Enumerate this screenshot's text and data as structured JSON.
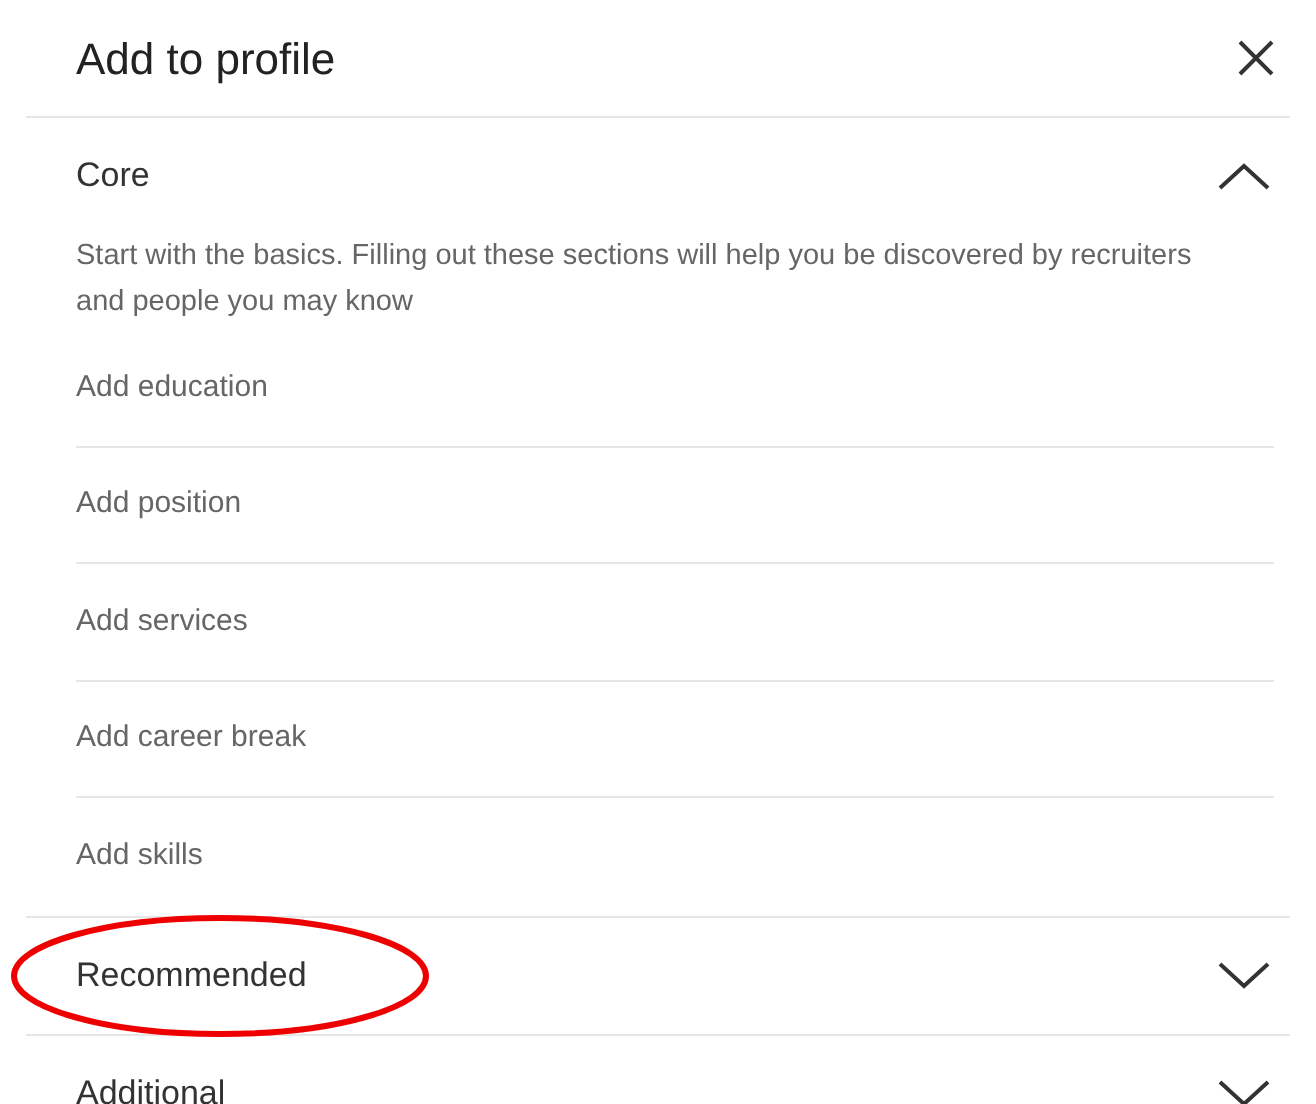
{
  "dialog": {
    "title": "Add to profile"
  },
  "sections": [
    {
      "title": "Core",
      "expanded": true,
      "circled": false,
      "description": "Start with the basics. Filling out these sections will help you be discovered by recruiters and people you may know",
      "items": [
        "Add education",
        "Add position",
        "Add services",
        "Add career break",
        "Add skills"
      ]
    },
    {
      "title": "Recommended",
      "expanded": false,
      "circled": true
    },
    {
      "title": "Additional",
      "expanded": false,
      "circled": false
    }
  ]
}
